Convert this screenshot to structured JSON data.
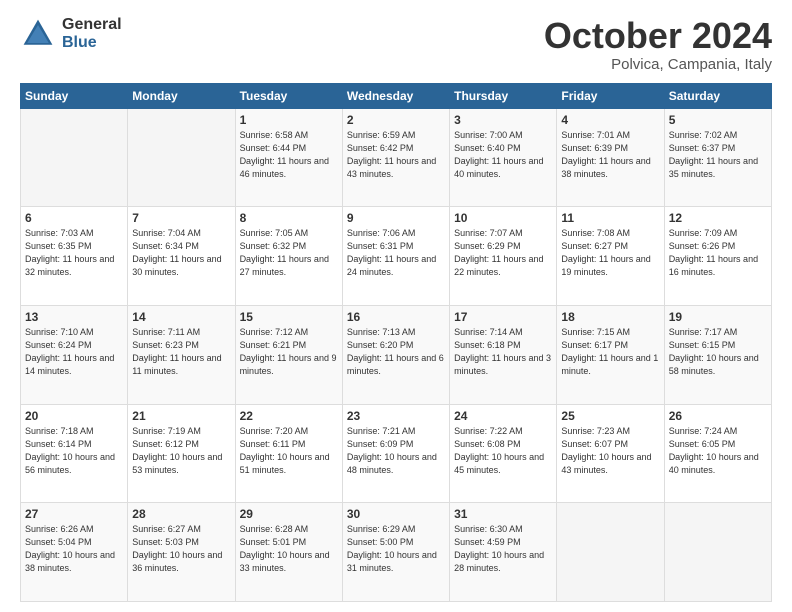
{
  "header": {
    "logo_general": "General",
    "logo_blue": "Blue",
    "month": "October 2024",
    "location": "Polvica, Campania, Italy"
  },
  "days_of_week": [
    "Sunday",
    "Monday",
    "Tuesday",
    "Wednesday",
    "Thursday",
    "Friday",
    "Saturday"
  ],
  "weeks": [
    [
      {
        "num": "",
        "sunrise": "",
        "sunset": "",
        "daylight": "",
        "empty": true
      },
      {
        "num": "",
        "sunrise": "",
        "sunset": "",
        "daylight": "",
        "empty": true
      },
      {
        "num": "1",
        "sunrise": "Sunrise: 6:58 AM",
        "sunset": "Sunset: 6:44 PM",
        "daylight": "Daylight: 11 hours and 46 minutes."
      },
      {
        "num": "2",
        "sunrise": "Sunrise: 6:59 AM",
        "sunset": "Sunset: 6:42 PM",
        "daylight": "Daylight: 11 hours and 43 minutes."
      },
      {
        "num": "3",
        "sunrise": "Sunrise: 7:00 AM",
        "sunset": "Sunset: 6:40 PM",
        "daylight": "Daylight: 11 hours and 40 minutes."
      },
      {
        "num": "4",
        "sunrise": "Sunrise: 7:01 AM",
        "sunset": "Sunset: 6:39 PM",
        "daylight": "Daylight: 11 hours and 38 minutes."
      },
      {
        "num": "5",
        "sunrise": "Sunrise: 7:02 AM",
        "sunset": "Sunset: 6:37 PM",
        "daylight": "Daylight: 11 hours and 35 minutes."
      }
    ],
    [
      {
        "num": "6",
        "sunrise": "Sunrise: 7:03 AM",
        "sunset": "Sunset: 6:35 PM",
        "daylight": "Daylight: 11 hours and 32 minutes."
      },
      {
        "num": "7",
        "sunrise": "Sunrise: 7:04 AM",
        "sunset": "Sunset: 6:34 PM",
        "daylight": "Daylight: 11 hours and 30 minutes."
      },
      {
        "num": "8",
        "sunrise": "Sunrise: 7:05 AM",
        "sunset": "Sunset: 6:32 PM",
        "daylight": "Daylight: 11 hours and 27 minutes."
      },
      {
        "num": "9",
        "sunrise": "Sunrise: 7:06 AM",
        "sunset": "Sunset: 6:31 PM",
        "daylight": "Daylight: 11 hours and 24 minutes."
      },
      {
        "num": "10",
        "sunrise": "Sunrise: 7:07 AM",
        "sunset": "Sunset: 6:29 PM",
        "daylight": "Daylight: 11 hours and 22 minutes."
      },
      {
        "num": "11",
        "sunrise": "Sunrise: 7:08 AM",
        "sunset": "Sunset: 6:27 PM",
        "daylight": "Daylight: 11 hours and 19 minutes."
      },
      {
        "num": "12",
        "sunrise": "Sunrise: 7:09 AM",
        "sunset": "Sunset: 6:26 PM",
        "daylight": "Daylight: 11 hours and 16 minutes."
      }
    ],
    [
      {
        "num": "13",
        "sunrise": "Sunrise: 7:10 AM",
        "sunset": "Sunset: 6:24 PM",
        "daylight": "Daylight: 11 hours and 14 minutes."
      },
      {
        "num": "14",
        "sunrise": "Sunrise: 7:11 AM",
        "sunset": "Sunset: 6:23 PM",
        "daylight": "Daylight: 11 hours and 11 minutes."
      },
      {
        "num": "15",
        "sunrise": "Sunrise: 7:12 AM",
        "sunset": "Sunset: 6:21 PM",
        "daylight": "Daylight: 11 hours and 9 minutes."
      },
      {
        "num": "16",
        "sunrise": "Sunrise: 7:13 AM",
        "sunset": "Sunset: 6:20 PM",
        "daylight": "Daylight: 11 hours and 6 minutes."
      },
      {
        "num": "17",
        "sunrise": "Sunrise: 7:14 AM",
        "sunset": "Sunset: 6:18 PM",
        "daylight": "Daylight: 11 hours and 3 minutes."
      },
      {
        "num": "18",
        "sunrise": "Sunrise: 7:15 AM",
        "sunset": "Sunset: 6:17 PM",
        "daylight": "Daylight: 11 hours and 1 minute."
      },
      {
        "num": "19",
        "sunrise": "Sunrise: 7:17 AM",
        "sunset": "Sunset: 6:15 PM",
        "daylight": "Daylight: 10 hours and 58 minutes."
      }
    ],
    [
      {
        "num": "20",
        "sunrise": "Sunrise: 7:18 AM",
        "sunset": "Sunset: 6:14 PM",
        "daylight": "Daylight: 10 hours and 56 minutes."
      },
      {
        "num": "21",
        "sunrise": "Sunrise: 7:19 AM",
        "sunset": "Sunset: 6:12 PM",
        "daylight": "Daylight: 10 hours and 53 minutes."
      },
      {
        "num": "22",
        "sunrise": "Sunrise: 7:20 AM",
        "sunset": "Sunset: 6:11 PM",
        "daylight": "Daylight: 10 hours and 51 minutes."
      },
      {
        "num": "23",
        "sunrise": "Sunrise: 7:21 AM",
        "sunset": "Sunset: 6:09 PM",
        "daylight": "Daylight: 10 hours and 48 minutes."
      },
      {
        "num": "24",
        "sunrise": "Sunrise: 7:22 AM",
        "sunset": "Sunset: 6:08 PM",
        "daylight": "Daylight: 10 hours and 45 minutes."
      },
      {
        "num": "25",
        "sunrise": "Sunrise: 7:23 AM",
        "sunset": "Sunset: 6:07 PM",
        "daylight": "Daylight: 10 hours and 43 minutes."
      },
      {
        "num": "26",
        "sunrise": "Sunrise: 7:24 AM",
        "sunset": "Sunset: 6:05 PM",
        "daylight": "Daylight: 10 hours and 40 minutes."
      }
    ],
    [
      {
        "num": "27",
        "sunrise": "Sunrise: 6:26 AM",
        "sunset": "Sunset: 5:04 PM",
        "daylight": "Daylight: 10 hours and 38 minutes."
      },
      {
        "num": "28",
        "sunrise": "Sunrise: 6:27 AM",
        "sunset": "Sunset: 5:03 PM",
        "daylight": "Daylight: 10 hours and 36 minutes."
      },
      {
        "num": "29",
        "sunrise": "Sunrise: 6:28 AM",
        "sunset": "Sunset: 5:01 PM",
        "daylight": "Daylight: 10 hours and 33 minutes."
      },
      {
        "num": "30",
        "sunrise": "Sunrise: 6:29 AM",
        "sunset": "Sunset: 5:00 PM",
        "daylight": "Daylight: 10 hours and 31 minutes."
      },
      {
        "num": "31",
        "sunrise": "Sunrise: 6:30 AM",
        "sunset": "Sunset: 4:59 PM",
        "daylight": "Daylight: 10 hours and 28 minutes."
      },
      {
        "num": "",
        "sunrise": "",
        "sunset": "",
        "daylight": "",
        "empty": true
      },
      {
        "num": "",
        "sunrise": "",
        "sunset": "",
        "daylight": "",
        "empty": true
      }
    ]
  ]
}
